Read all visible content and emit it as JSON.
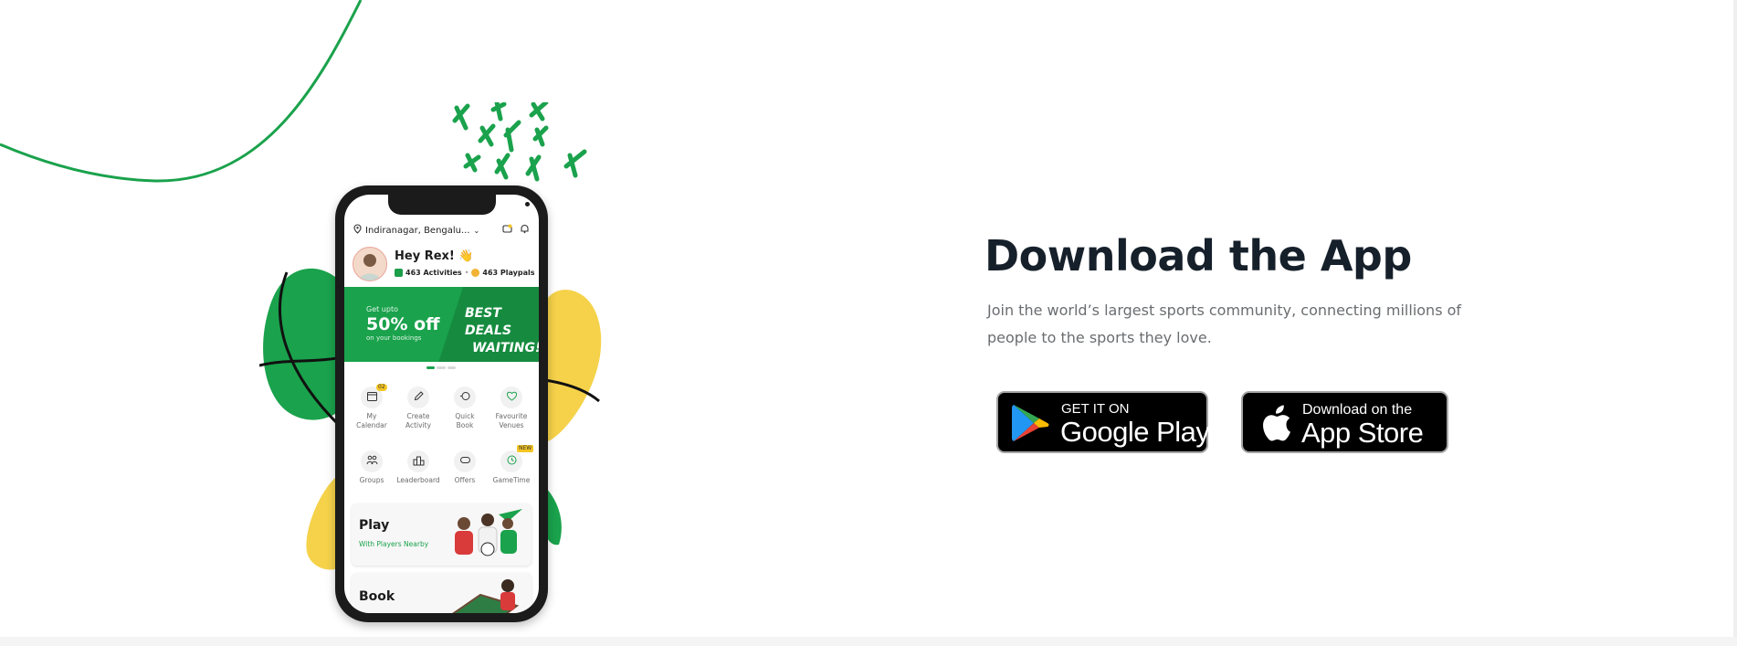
{
  "phone": {
    "location": "Indiranagar, Bengalu...",
    "greeting": "Hey Rex! 👋",
    "activities": "463 Activities",
    "separator": "•",
    "playpals": "463 Playpals",
    "banner": {
      "kicker": "Get upto",
      "headline": "50% off",
      "subline": "on your bookings",
      "deals_line1": "BEST DEALS",
      "deals_line2": "WAITING!"
    },
    "tiles_row1": [
      {
        "label1": "My",
        "label2": "Calendar",
        "badge": "02"
      },
      {
        "label1": "Create",
        "label2": "Activity"
      },
      {
        "label1": "Quick",
        "label2": "Book"
      },
      {
        "label1": "Favourite",
        "label2": "Venues"
      }
    ],
    "tiles_row2": [
      {
        "label1": "Groups"
      },
      {
        "label1": "Leaderboard"
      },
      {
        "label1": "Offers"
      },
      {
        "label1": "GameTime",
        "badge": "NEW"
      }
    ],
    "cards": {
      "play_title": "Play",
      "play_sub": "With Players Nearby",
      "book_title": "Book"
    }
  },
  "section": {
    "headline": "Download the App",
    "description": "Join the world’s largest sports community, connecting millions of people to the sports they love."
  },
  "stores": {
    "google_small": "GET IT ON",
    "google_big": "Google Play",
    "apple_small": "Download on the",
    "apple_big": "App Store"
  },
  "colors": {
    "brand_green": "#1aa24c",
    "accent_yellow": "#f5d24a",
    "headline": "#16202b",
    "body_text": "#6a6d70"
  },
  "icons": [
    "location-pin-icon",
    "chevron-down-icon",
    "wallet-icon",
    "bell-icon",
    "calendar-icon",
    "pencil-icon",
    "quick-book-icon",
    "heart-icon",
    "groups-icon",
    "leaderboard-icon",
    "offers-icon",
    "gametime-icon",
    "google-play-icon",
    "apple-icon"
  ]
}
